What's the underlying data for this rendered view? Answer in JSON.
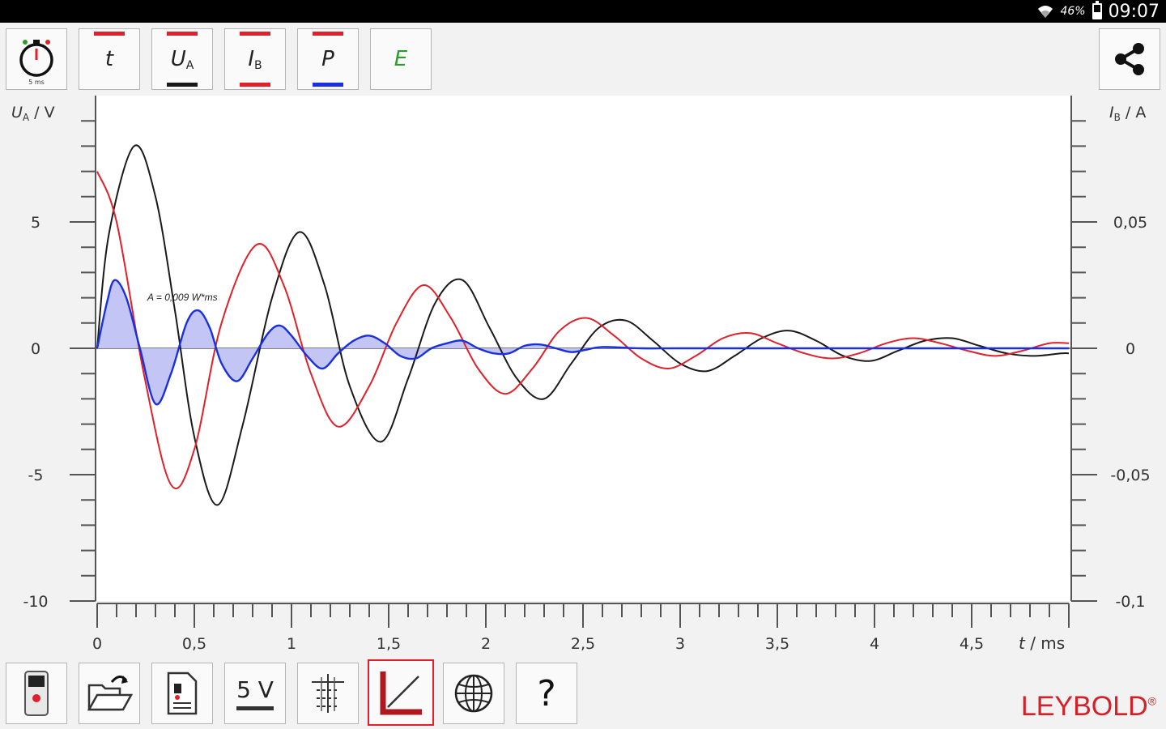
{
  "status": {
    "battery_pct": "46%",
    "time": "09:07"
  },
  "toolbar": {
    "timer_label": "5 ms",
    "buttons": [
      {
        "name": "t",
        "label": "t",
        "sub": ""
      },
      {
        "name": "ua",
        "label": "U",
        "sub": "A"
      },
      {
        "name": "ib",
        "label": "I",
        "sub": "B"
      },
      {
        "name": "p",
        "label": "P",
        "sub": ""
      },
      {
        "name": "e",
        "label": "E",
        "sub": ""
      }
    ]
  },
  "colors": {
    "ua": "#1a1a1a",
    "ib": "#e0202a",
    "p": "#1a2fe0",
    "e": "#2e9a2e",
    "accent": "#d62028"
  },
  "chart_data": {
    "type": "line",
    "xlabel": "t / ms",
    "ylabel_left": "UA / V",
    "ylabel_right": "IB / A",
    "xlim": [
      0,
      5
    ],
    "ylim_left": [
      -10,
      9.8
    ],
    "ylim_right": [
      -0.1,
      0.098
    ],
    "x_ticks": [
      "0",
      "0,5",
      "1",
      "1,5",
      "2",
      "2,5",
      "3",
      "3,5",
      "4",
      "4,5"
    ],
    "y_ticks_left": [
      "5",
      "0",
      "-5",
      "-10"
    ],
    "y_ticks_right": [
      "0,05",
      "0",
      "-0,05",
      "-0,1"
    ],
    "annotation": "A = 0,009 W*ms",
    "series": [
      {
        "name": "UA",
        "axis": "left",
        "color": "#1a1a1a",
        "x": [
          0,
          0.06,
          0.19,
          0.3,
          0.4,
          0.5,
          0.62,
          0.75,
          0.9,
          1.04,
          1.17,
          1.3,
          1.46,
          1.6,
          1.74,
          1.88,
          2.02,
          2.16,
          2.3,
          2.44,
          2.58,
          2.72,
          2.86,
          3.0,
          3.14,
          3.28,
          3.42,
          3.56,
          3.7,
          3.84,
          3.98,
          4.12,
          4.26,
          4.4,
          4.54,
          4.68,
          4.82,
          4.96,
          5.0
        ],
        "y": [
          0,
          4.5,
          8.0,
          6.0,
          1.5,
          -3.5,
          -6.2,
          -3.0,
          2.0,
          4.6,
          2.5,
          -1.5,
          -3.7,
          -1.2,
          1.8,
          2.7,
          0.8,
          -1.2,
          -2.0,
          -0.6,
          0.8,
          1.1,
          0.3,
          -0.6,
          -0.9,
          -0.3,
          0.4,
          0.7,
          0.3,
          -0.3,
          -0.5,
          -0.1,
          0.3,
          0.4,
          0.1,
          -0.2,
          -0.3,
          -0.2,
          -0.2
        ]
      },
      {
        "name": "IB",
        "axis": "right",
        "color": "#e0202a",
        "x": [
          0,
          0.1,
          0.24,
          0.38,
          0.5,
          0.64,
          0.82,
          0.96,
          1.1,
          1.24,
          1.4,
          1.54,
          1.68,
          1.82,
          1.96,
          2.1,
          2.24,
          2.38,
          2.52,
          2.66,
          2.8,
          2.94,
          3.08,
          3.22,
          3.36,
          3.5,
          3.64,
          3.78,
          3.92,
          4.06,
          4.2,
          4.34,
          4.48,
          4.62,
          4.76,
          4.9,
          5.0
        ],
        "y": [
          0.07,
          0.05,
          -0.01,
          -0.054,
          -0.04,
          0.01,
          0.041,
          0.025,
          -0.01,
          -0.031,
          -0.015,
          0.01,
          0.025,
          0.012,
          -0.008,
          -0.018,
          -0.008,
          0.007,
          0.012,
          0.005,
          -0.004,
          -0.008,
          -0.003,
          0.004,
          0.006,
          0.002,
          -0.002,
          -0.004,
          -0.002,
          0.002,
          0.004,
          0.002,
          -0.001,
          -0.003,
          -0.001,
          0.002,
          0.002
        ]
      },
      {
        "name": "P",
        "axis": "left",
        "color": "#1a2fe0",
        "fill": "#c3c6f5",
        "x": [
          0,
          0.05,
          0.09,
          0.15,
          0.22,
          0.3,
          0.38,
          0.46,
          0.52,
          0.58,
          0.64,
          0.72,
          0.8,
          0.88,
          0.94,
          1.0,
          1.08,
          1.16,
          1.24,
          1.32,
          1.4,
          1.48,
          1.56,
          1.64,
          1.72,
          1.8,
          1.88,
          1.96,
          2.04,
          2.12,
          2.2,
          2.28,
          2.36,
          2.44,
          2.52,
          2.6,
          2.8,
          3.0,
          3.5,
          4.0,
          5.0
        ],
        "y": [
          0,
          1.8,
          2.7,
          2.0,
          0,
          -2.2,
          -1.0,
          1.0,
          1.5,
          0.8,
          -0.6,
          -1.3,
          -0.4,
          0.6,
          0.9,
          0.5,
          -0.3,
          -0.8,
          -0.2,
          0.3,
          0.5,
          0.2,
          -0.3,
          -0.4,
          0,
          0.2,
          0.3,
          0,
          -0.2,
          -0.2,
          0.1,
          0.15,
          0,
          -0.15,
          -0.05,
          0.05,
          0,
          0,
          0,
          0,
          0
        ]
      }
    ]
  },
  "bottom_toolbar": [
    {
      "name": "device-button",
      "label": ""
    },
    {
      "name": "open-file-button",
      "label": ""
    },
    {
      "name": "export-document-button",
      "label": ""
    },
    {
      "name": "range-5v-button",
      "label": "5 V"
    },
    {
      "name": "cursor-settings-button",
      "label": ""
    },
    {
      "name": "graph-view-button",
      "label": ""
    },
    {
      "name": "language-button",
      "label": ""
    },
    {
      "name": "help-button",
      "label": "?"
    }
  ],
  "brand": {
    "name": "LEYBOLD",
    "mark": "®"
  }
}
